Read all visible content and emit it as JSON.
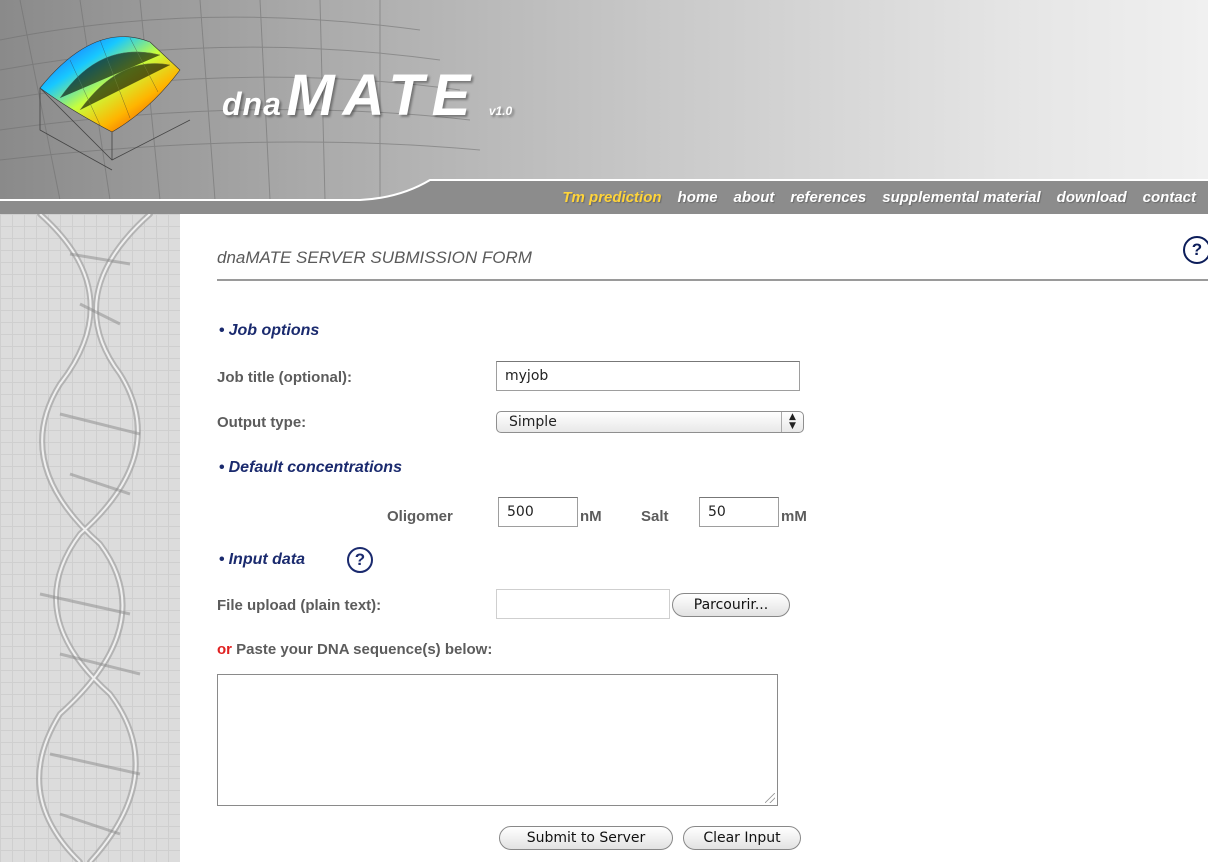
{
  "header": {
    "logo": {
      "prefix": "dna",
      "name": "MATE",
      "version": "v1.0"
    },
    "nav": [
      {
        "label": "Tm prediction",
        "active": true
      },
      {
        "label": "home"
      },
      {
        "label": "about"
      },
      {
        "label": "references"
      },
      {
        "label": "supplemental material"
      },
      {
        "label": "download"
      },
      {
        "label": "contact"
      }
    ]
  },
  "form": {
    "title": "dnaMATE SERVER SUBMISSION FORM",
    "help_icon": "question-circle-icon",
    "job_options": {
      "section_label": "Job options",
      "job_title_label": "Job title (optional):",
      "job_title_value": "myjob",
      "output_type_label": "Output type:",
      "output_type_value": "Simple"
    },
    "concentrations": {
      "section_label": "Default concentrations",
      "oligomer_label": "Oligomer",
      "oligomer_value": "500",
      "oligomer_unit": "nM",
      "salt_label": "Salt",
      "salt_value": "50",
      "salt_unit": "mM"
    },
    "input_data": {
      "section_label": "Input data",
      "file_upload_label": "File upload (plain text):",
      "browse_button": "Parcourir...",
      "paste_or": "or",
      "paste_label": "Paste your DNA sequence(s) below:",
      "sequence_value": ""
    },
    "buttons": {
      "submit": "Submit to Server",
      "clear": "Clear Input"
    }
  },
  "colors": {
    "nav_active": "#ffd43a",
    "section_heading": "#1a2a6e",
    "or_highlight": "#e02020"
  }
}
